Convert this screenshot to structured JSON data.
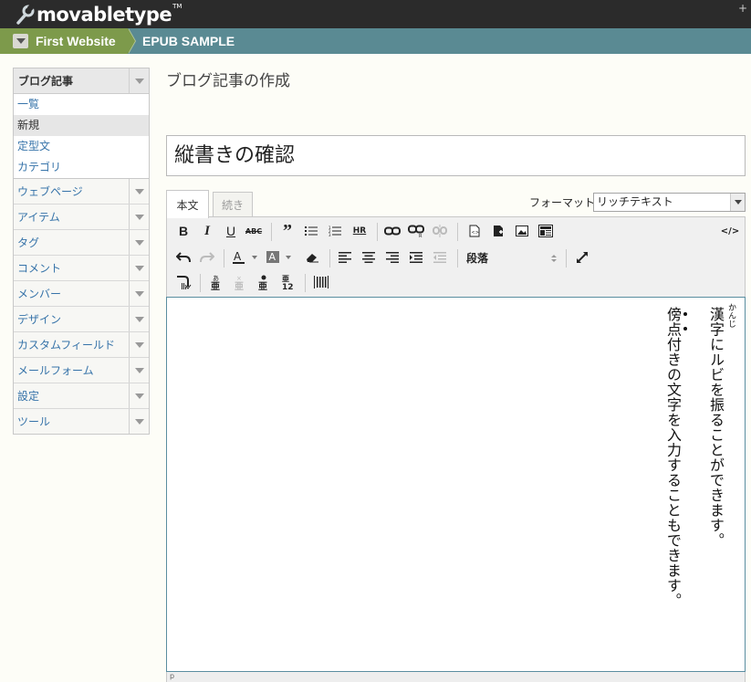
{
  "header": {
    "brand": "movabletype",
    "brand_tm": "TM",
    "plus": "+"
  },
  "sitebar": {
    "website": "First Website",
    "blog": "EPUB SAMPLE"
  },
  "sidebar": {
    "head": "ブログ記事",
    "sub_items": [
      "一覧",
      "新規",
      "定型文",
      "カテゴリ"
    ],
    "sections": [
      "ウェブページ",
      "アイテム",
      "タグ",
      "コメント",
      "メンバー",
      "デザイン",
      "カスタムフィールド",
      "メールフォーム",
      "設定",
      "ツール"
    ]
  },
  "main": {
    "page_title": "ブログ記事の作成",
    "title_value": "縦書きの確認",
    "tabs": [
      "本文",
      "続き"
    ],
    "format_label": "フォーマット:",
    "format_value": "リッチテキスト",
    "paragraph_select": "段落",
    "source_toggle": "</>"
  },
  "editor": {
    "line1": "漢字にルビを振ることができます。",
    "ruby": "かんじ",
    "line2": "傍点付きの文字を入力することもできます。"
  },
  "status": {
    "path": "p"
  },
  "colors": {
    "topbar": "#2b2b2b",
    "sitebar": "#5a8a93",
    "website_bg": "#7d9a4b",
    "link": "#3673a9"
  }
}
